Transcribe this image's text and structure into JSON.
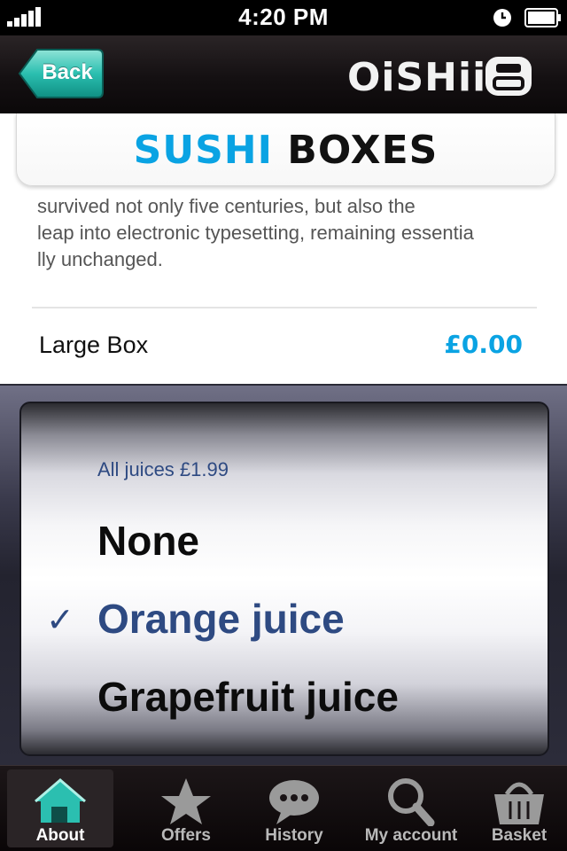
{
  "status_bar": {
    "time": "4:20 PM",
    "icons": [
      "signal-icon",
      "clock-icon",
      "battery-icon"
    ]
  },
  "navbar": {
    "back_label": "Back",
    "logo_text": "OiSHii",
    "back_color": "#2bbfb0"
  },
  "page": {
    "title_word1": "SUSHI",
    "title_word2": "BOXES",
    "accent": "#0aa3e3",
    "description_lines": [
      "survived not only five centuries, but also the",
      "leap into electronic typesetting, remaining essentia",
      "lly unchanged."
    ],
    "item_name": "Large Box",
    "item_price": "£0.00"
  },
  "picker": {
    "section_label": "All juices £1.99",
    "options": [
      "None",
      "Orange juice",
      "Grapefruit juice"
    ],
    "selected_index": 1,
    "check_mark": "✓",
    "selected_color": "#2e4a82"
  },
  "tabbar": {
    "tabs": [
      {
        "label": "About",
        "icon": "home-icon",
        "active": true
      },
      {
        "label": "Offers",
        "icon": "star-icon",
        "active": false
      },
      {
        "label": "History",
        "icon": "chat-bubble-icon",
        "active": false
      },
      {
        "label": "My account",
        "icon": "search-icon",
        "active": false
      },
      {
        "label": "Basket",
        "icon": "basket-icon",
        "active": false
      }
    ]
  }
}
